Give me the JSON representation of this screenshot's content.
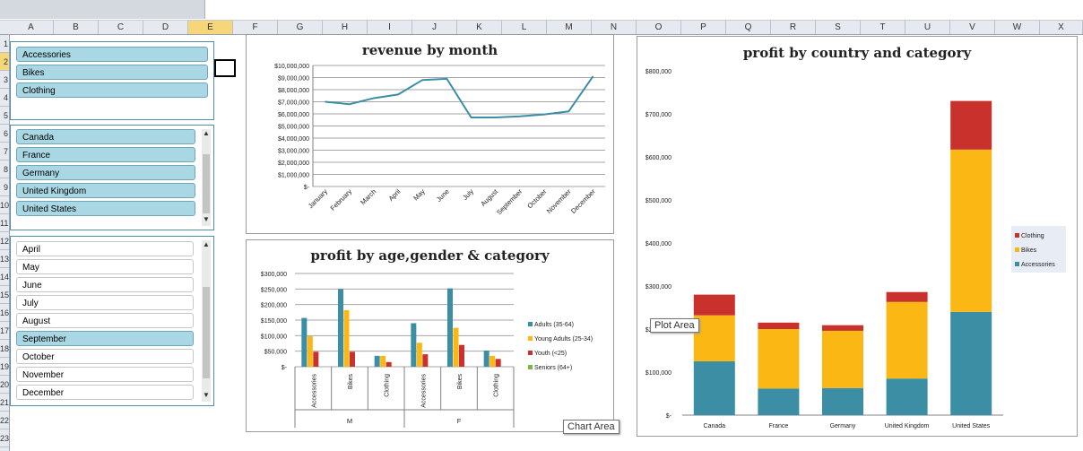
{
  "columns": [
    "A",
    "B",
    "C",
    "D",
    "E",
    "F",
    "G",
    "H",
    "I",
    "J",
    "K",
    "L",
    "M",
    "N",
    "O",
    "P",
    "Q",
    "R",
    "S",
    "T",
    "U",
    "V",
    "W",
    "X"
  ],
  "active_column": "E",
  "rows": [
    "1",
    "2",
    "3",
    "4",
    "5",
    "6",
    "7",
    "8",
    "9",
    "10",
    "11",
    "12",
    "13",
    "14",
    "15",
    "16",
    "17",
    "18",
    "19",
    "20",
    "21",
    "22",
    "23"
  ],
  "active_row": "2",
  "slicers": {
    "category": {
      "items": [
        {
          "label": "Accessories",
          "selected": true
        },
        {
          "label": "Bikes",
          "selected": true
        },
        {
          "label": "Clothing",
          "selected": true
        }
      ]
    },
    "country": {
      "items": [
        {
          "label": "Canada",
          "selected": true
        },
        {
          "label": "France",
          "selected": true
        },
        {
          "label": "Germany",
          "selected": true
        },
        {
          "label": "United Kingdom",
          "selected": true
        },
        {
          "label": "United States",
          "selected": true
        }
      ]
    },
    "month": {
      "items": [
        {
          "label": "April",
          "selected": false
        },
        {
          "label": "May",
          "selected": false
        },
        {
          "label": "June",
          "selected": false
        },
        {
          "label": "July",
          "selected": false
        },
        {
          "label": "August",
          "selected": false
        },
        {
          "label": "September",
          "selected": true
        },
        {
          "label": "October",
          "selected": false
        },
        {
          "label": "November",
          "selected": false
        },
        {
          "label": "December",
          "selected": false
        }
      ]
    }
  },
  "tooltips": {
    "plot_area": "Plot Area",
    "chart_area": "Chart Area"
  },
  "chart_data": [
    {
      "id": "revenue",
      "type": "line",
      "title": "revenue by month",
      "categories": [
        "January",
        "February",
        "March",
        "April",
        "May",
        "June",
        "July",
        "August",
        "September",
        "October",
        "November",
        "December"
      ],
      "values": [
        7000000,
        6800000,
        7300000,
        7600000,
        8800000,
        8900000,
        5700000,
        5700000,
        5800000,
        5950000,
        6200000,
        9100000
      ],
      "ylim": [
        0,
        10000000
      ],
      "yticks": [
        "$-",
        "$1,000,000",
        "$2,000,000",
        "$3,000,000",
        "$4,000,000",
        "$5,000,000",
        "$6,000,000",
        "$7,000,000",
        "$8,000,000",
        "$9,000,000",
        "$10,000,000"
      ],
      "color": "#3c8ea4"
    },
    {
      "id": "agegender",
      "type": "bar",
      "title": "profit by age,gender & category",
      "groups": [
        {
          "label": "M",
          "categories": [
            "Accessories",
            "Bikes",
            "Clothing"
          ]
        },
        {
          "label": "F",
          "categories": [
            "Accessories",
            "Bikes",
            "Clothing"
          ]
        }
      ],
      "series": [
        {
          "name": "Adults (35-64)",
          "color": "#3c8ea4",
          "values": [
            157000,
            250000,
            35000,
            140000,
            252000,
            52000
          ]
        },
        {
          "name": "Young Adults (25-34)",
          "color": "#fbb714",
          "values": [
            98000,
            182000,
            35000,
            77000,
            125000,
            35000
          ]
        },
        {
          "name": "Youth (<25)",
          "color": "#c8312c",
          "values": [
            48000,
            48000,
            15000,
            40000,
            70000,
            25000
          ]
        },
        {
          "name": "Seniors (64+)",
          "color": "#7ab648",
          "values": [
            0,
            0,
            0,
            0,
            0,
            0
          ]
        }
      ],
      "ylim": [
        0,
        300000
      ],
      "yticks": [
        "$-",
        "$50,000",
        "$100,000",
        "$150,000",
        "$200,000",
        "$250,000",
        "$300,000"
      ]
    },
    {
      "id": "country",
      "type": "bar",
      "stacked": true,
      "title": "profit by country and category",
      "categories": [
        "Canada",
        "France",
        "Germany",
        "United Kingdom",
        "United States"
      ],
      "series": [
        {
          "name": "Accessories",
          "color": "#3c8ea4",
          "values": [
            125000,
            62000,
            63000,
            85000,
            240000
          ]
        },
        {
          "name": "Bikes",
          "color": "#fbb714",
          "values": [
            107000,
            138000,
            133000,
            178000,
            377000
          ]
        },
        {
          "name": "Clothing",
          "color": "#c8312c",
          "values": [
            48000,
            15000,
            13000,
            23000,
            113000
          ]
        }
      ],
      "ylim": [
        0,
        800000
      ],
      "yticks": [
        "$-",
        "$100,000",
        "$200,000",
        "$300,000",
        "$400,000",
        "$500,000",
        "$600,000",
        "$700,000",
        "$800,000"
      ],
      "legend_order": [
        "Clothing",
        "Bikes",
        "Accessories"
      ]
    }
  ]
}
